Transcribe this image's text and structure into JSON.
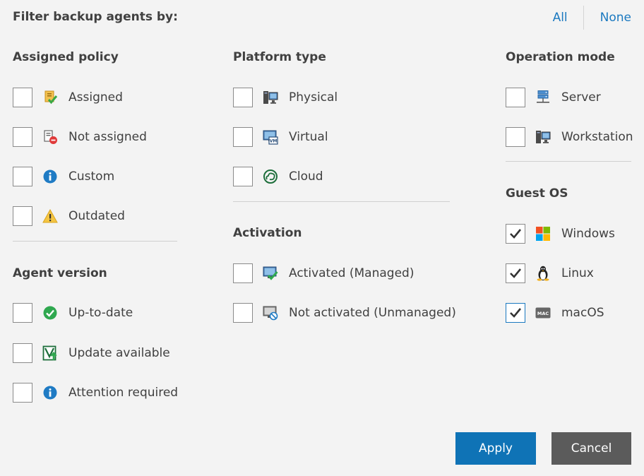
{
  "header": {
    "title": "Filter backup agents by:",
    "all_label": "All",
    "none_label": "None"
  },
  "assigned_policy": {
    "title": "Assigned policy",
    "items": [
      {
        "label": "Assigned",
        "icon": "policy-assigned-icon",
        "checked": false
      },
      {
        "label": "Not assigned",
        "icon": "policy-not-assigned-icon",
        "checked": false
      },
      {
        "label": "Custom",
        "icon": "info-icon",
        "checked": false
      },
      {
        "label": "Outdated",
        "icon": "warning-icon",
        "checked": false
      }
    ]
  },
  "agent_version": {
    "title": "Agent version",
    "items": [
      {
        "label": "Up-to-date",
        "icon": "check-circle-icon",
        "checked": false
      },
      {
        "label": "Update available",
        "icon": "update-available-icon",
        "checked": false
      },
      {
        "label": "Attention required",
        "icon": "info-icon",
        "checked": false
      }
    ]
  },
  "platform_type": {
    "title": "Platform type",
    "items": [
      {
        "label": "Physical",
        "icon": "physical-computer-icon",
        "checked": false
      },
      {
        "label": "Virtual",
        "icon": "virtual-machine-icon",
        "checked": false
      },
      {
        "label": "Cloud",
        "icon": "cloud-icon",
        "checked": false
      }
    ]
  },
  "activation": {
    "title": "Activation",
    "items": [
      {
        "label": "Activated (Managed)",
        "icon": "activated-icon",
        "checked": false
      },
      {
        "label": "Not activated (Unmanaged)",
        "icon": "not-activated-icon",
        "checked": false
      }
    ]
  },
  "operation_mode": {
    "title": "Operation mode",
    "items": [
      {
        "label": "Server",
        "icon": "server-icon",
        "checked": false
      },
      {
        "label": "Workstation",
        "icon": "workstation-icon",
        "checked": false
      }
    ]
  },
  "guest_os": {
    "title": "Guest OS",
    "items": [
      {
        "label": "Windows",
        "icon": "windows-icon",
        "checked": true
      },
      {
        "label": "Linux",
        "icon": "linux-icon",
        "checked": true
      },
      {
        "label": "macOS",
        "icon": "macos-icon",
        "checked": true
      }
    ]
  },
  "icon_badge_text": {
    "mac": "MAC",
    "vm": "VM"
  },
  "buttons": {
    "apply": "Apply",
    "cancel": "Cancel"
  },
  "colors": {
    "accent": "#1b79c0",
    "apply_bg": "#0f73b6",
    "cancel_bg": "#5b5b5b",
    "background": "#f3f3f3"
  }
}
